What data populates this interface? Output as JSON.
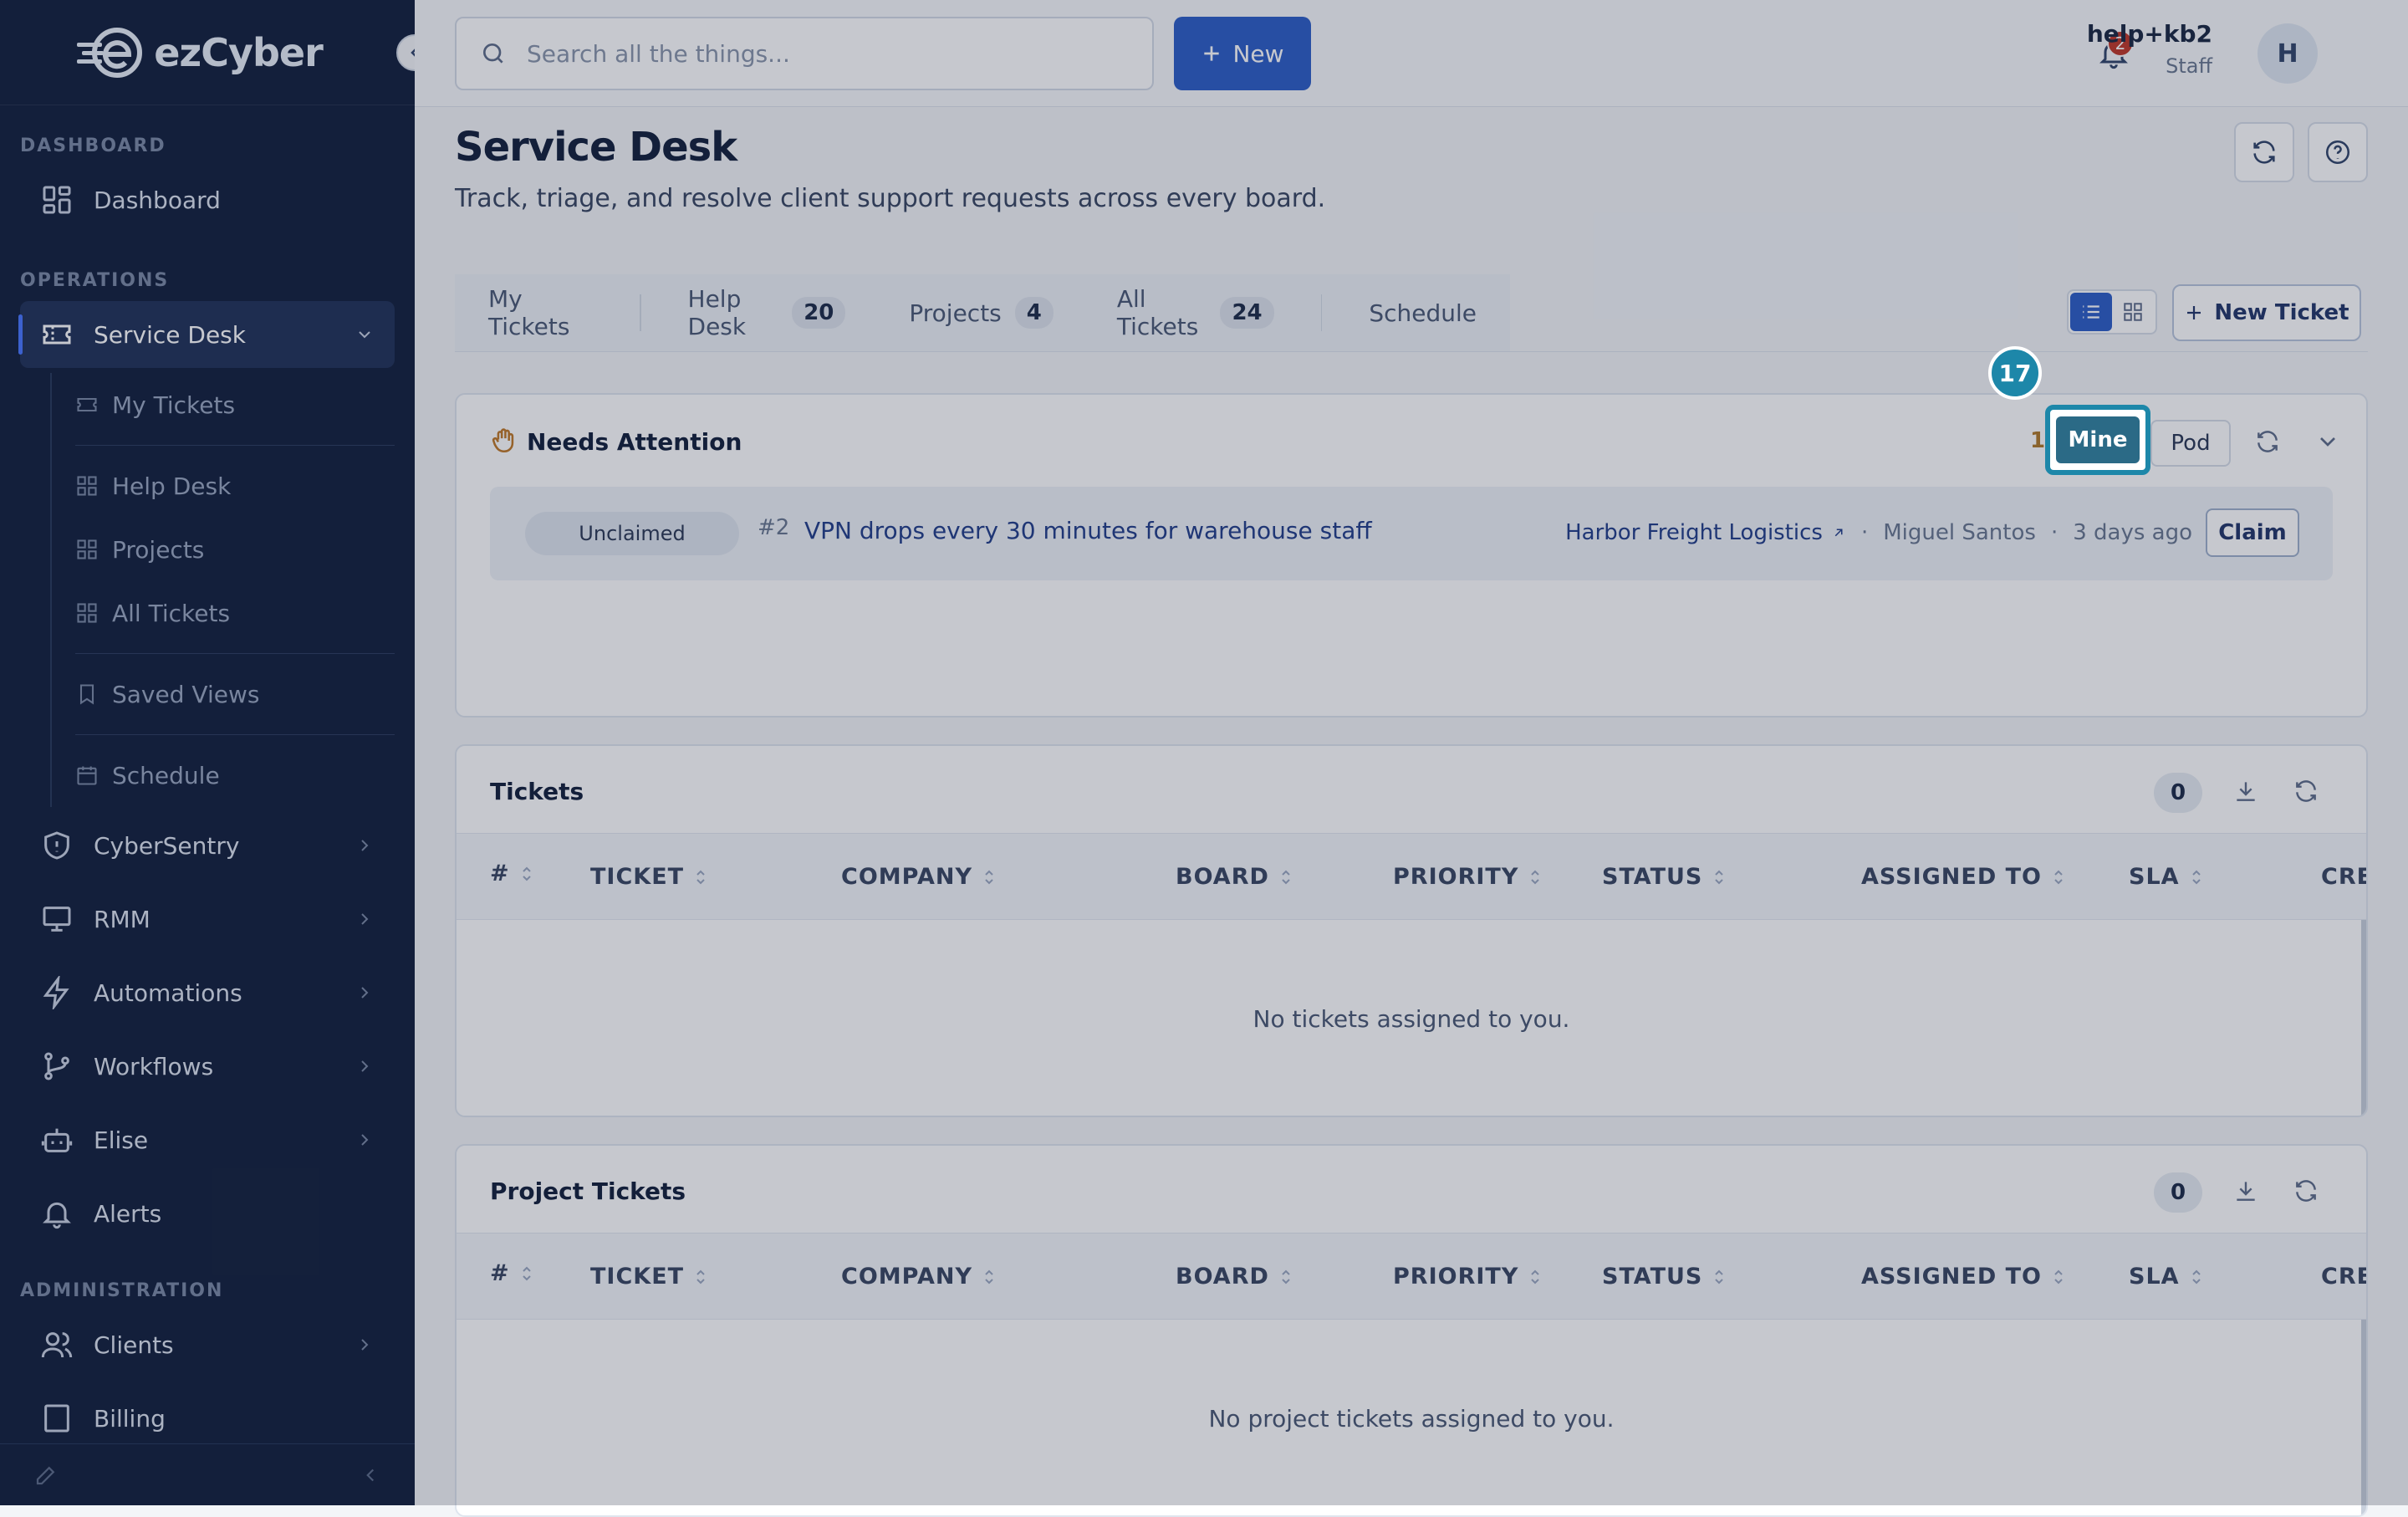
{
  "brand": {
    "name": "ezCyber"
  },
  "sidebar": {
    "sections": {
      "dashboard": "DASHBOARD",
      "operations": "OPERATIONS",
      "administration": "ADMINISTRATION"
    },
    "dashboard_label": "Dashboard",
    "service_desk": {
      "label": "Service Desk",
      "children": [
        "My Tickets",
        "Help Desk",
        "Projects",
        "All Tickets",
        "Saved Views",
        "Schedule"
      ]
    },
    "items": [
      "CyberSentry",
      "RMM",
      "Automations",
      "Workflows",
      "Elise",
      "Alerts"
    ],
    "admin_items": [
      "Clients",
      "Billing"
    ]
  },
  "topbar": {
    "search_placeholder": "Search all the things...",
    "new_label": "New",
    "notification_count": "2",
    "user_name": "help+kb2",
    "user_role": "Staff",
    "avatar_initial": "H"
  },
  "page": {
    "title": "Service Desk",
    "subtitle": "Track, triage, and resolve client support requests across every board."
  },
  "tabs": [
    {
      "label": "My Tickets",
      "count": ""
    },
    {
      "label": "Help Desk",
      "count": "20"
    },
    {
      "label": "Projects",
      "count": "4"
    },
    {
      "label": "All Tickets",
      "count": "24"
    },
    {
      "label": "Schedule",
      "count": ""
    }
  ],
  "new_ticket_label": "New Ticket",
  "needs_attention": {
    "title": "Needs Attention",
    "count": "1",
    "mine_label": "Mine",
    "pod_label": "Pod",
    "ticket": {
      "status": "Unclaimed",
      "number": "#2",
      "title": "VPN drops every 30 minutes for warehouse staff",
      "company": "Harbor Freight Logistics",
      "contact": "Miguel Santos",
      "age": "3 days ago",
      "action": "Claim"
    }
  },
  "columns": [
    "#",
    "TICKET",
    "COMPANY",
    "BOARD",
    "PRIORITY",
    "STATUS",
    "ASSIGNED TO",
    "SLA",
    "CRE"
  ],
  "tickets_card": {
    "title": "Tickets",
    "count": "0",
    "empty": "No tickets assigned to you."
  },
  "project_card": {
    "title": "Project Tickets",
    "count": "0",
    "empty": "No project tickets assigned to you."
  },
  "annotation": {
    "step": "17"
  },
  "colors": {
    "primary": "#2f5fc7",
    "sidebar": "#15223e",
    "highlight": "#1d87a9"
  }
}
